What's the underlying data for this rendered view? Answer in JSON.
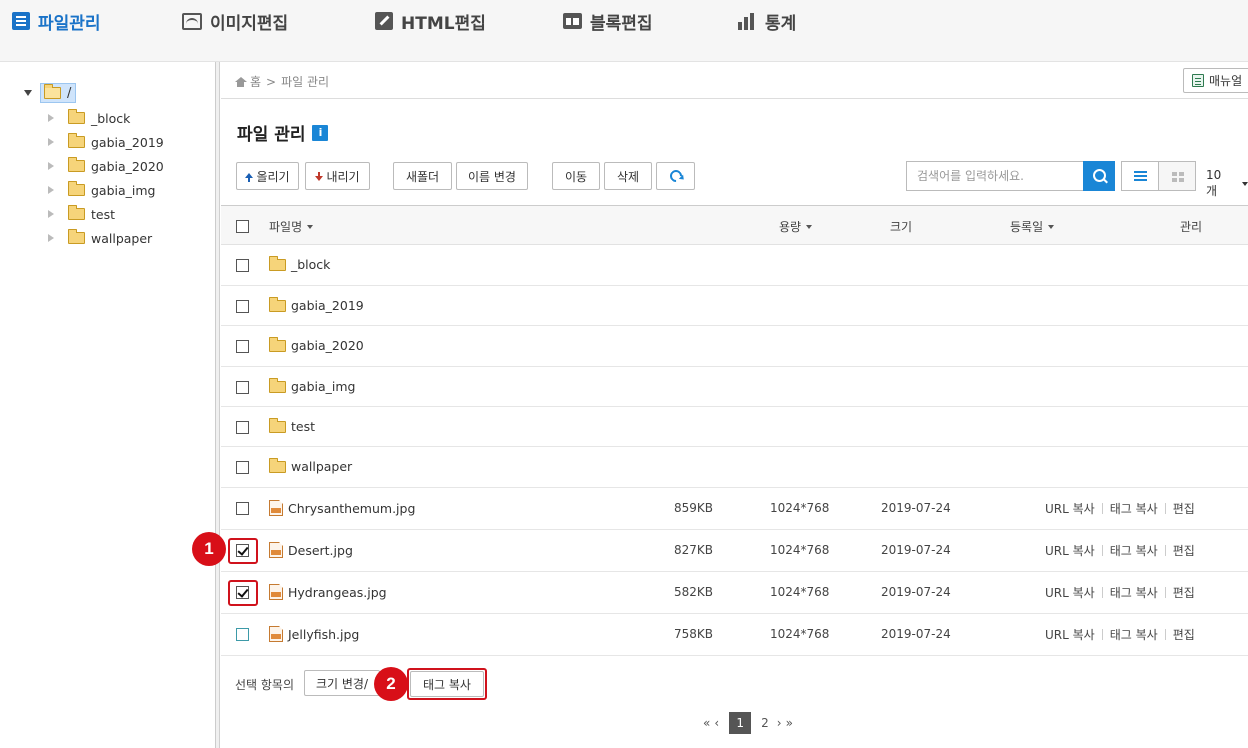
{
  "nav": {
    "items": [
      {
        "label": "파일관리",
        "icon": "file-list-icon",
        "active": true
      },
      {
        "label": "이미지편집",
        "icon": "image-icon"
      },
      {
        "label": "HTML편집",
        "icon": "pencil-icon"
      },
      {
        "label": "블록편집",
        "icon": "block-icon"
      },
      {
        "label": "통계",
        "icon": "stats-icon"
      }
    ]
  },
  "tree": {
    "root": "/",
    "children": [
      "_block",
      "gabia_2019",
      "gabia_2020",
      "gabia_img",
      "test",
      "wallpaper"
    ]
  },
  "breadcrumb": {
    "home": "홈",
    "sep": ">",
    "current": "파일 관리"
  },
  "manual_label": "매뉴얼",
  "page_title": "파일 관리",
  "info_icon_text": "i",
  "toolbar": {
    "up": "올리기",
    "down": "내리기",
    "new_folder": "새폴더",
    "rename": "이름 변경",
    "move": "이동",
    "delete": "삭제"
  },
  "search": {
    "placeholder": "검색어를 입력하세요."
  },
  "per_page": "10개",
  "columns": {
    "name": "파일명",
    "size": "용량",
    "dimension": "크기",
    "date": "등록일",
    "manage": "관리"
  },
  "folders": [
    "_block",
    "gabia_2019",
    "gabia_2020",
    "gabia_img",
    "test",
    "wallpaper"
  ],
  "files": [
    {
      "name": "Chrysanthemum.jpg",
      "size": "859KB",
      "dim": "1024*768",
      "date": "2019-07-24",
      "checked": false
    },
    {
      "name": "Desert.jpg",
      "size": "827KB",
      "dim": "1024*768",
      "date": "2019-07-24",
      "checked": true
    },
    {
      "name": "Hydrangeas.jpg",
      "size": "582KB",
      "dim": "1024*768",
      "date": "2019-07-24",
      "checked": true
    },
    {
      "name": "Jellyfish.jpg",
      "size": "758KB",
      "dim": "1024*768",
      "date": "2019-07-24",
      "checked": false
    }
  ],
  "row_actions": {
    "url_copy": "URL 복사",
    "tag_copy": "태그 복사",
    "edit": "편집"
  },
  "bottom": {
    "selected_label": "선택 항목의",
    "resize_btn": "크기 변경/",
    "tag_copy_btn": "태그 복사"
  },
  "badges": [
    "1",
    "2"
  ],
  "pagination": {
    "first": "«",
    "prev": "‹",
    "pages": [
      "1",
      "2"
    ],
    "current": "1",
    "next": "›",
    "last": "»"
  },
  "colors": {
    "accent": "#1a86d6",
    "highlight": "#d0121c"
  }
}
